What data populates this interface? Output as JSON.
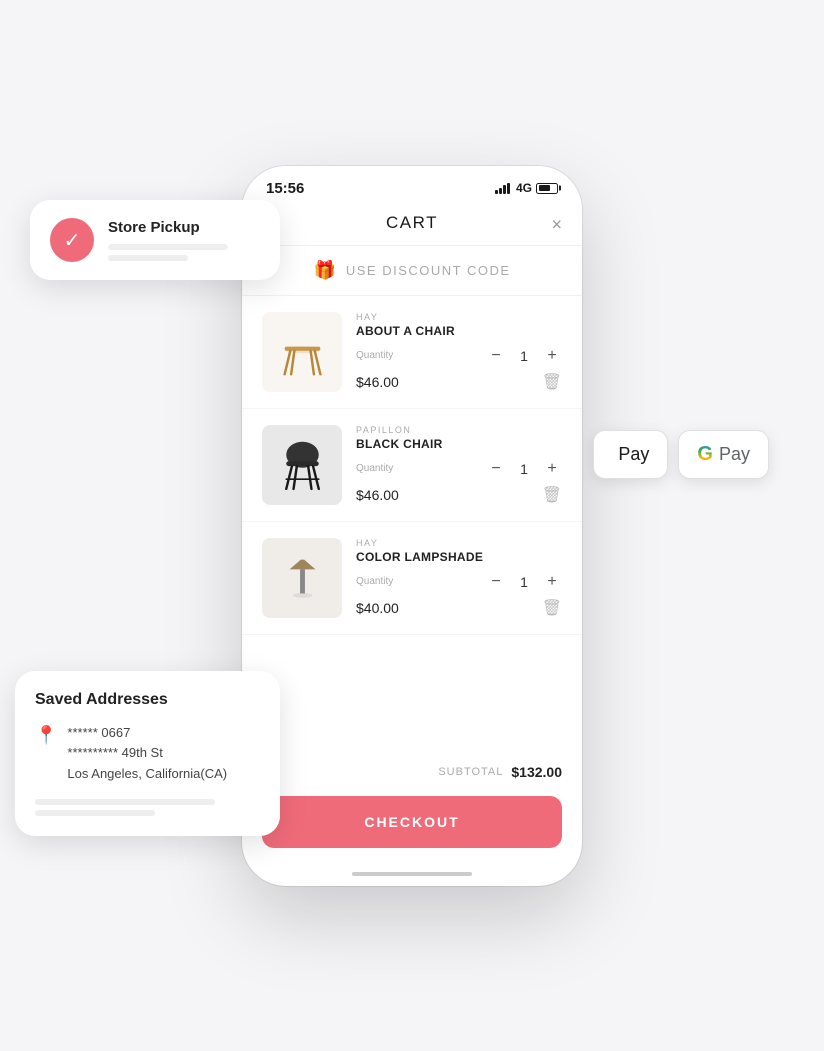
{
  "status_bar": {
    "time": "15:56",
    "network": "4G"
  },
  "header": {
    "title": "CART",
    "close_label": "×"
  },
  "discount": {
    "button_label": "USE DISCOUNT CODE"
  },
  "cart_items": [
    {
      "id": "item-1",
      "category": "HAY",
      "name": "ABOUT A CHAIR",
      "quantity": 1,
      "price": "$46.00",
      "qty_label": "Quantity",
      "type": "chair"
    },
    {
      "id": "item-2",
      "category": "PAPILLON",
      "name": "BLACK CHAIR",
      "quantity": 1,
      "price": "$46.00",
      "qty_label": "Quantity",
      "type": "black-chair"
    },
    {
      "id": "item-3",
      "category": "HAY",
      "name": "COLOR LAMPSHADE",
      "quantity": 1,
      "price": "$40.00",
      "qty_label": "Quantity",
      "type": "lamp"
    }
  ],
  "subtotal": {
    "label": "SUBTOTAL",
    "amount": "$132.00"
  },
  "checkout_button": {
    "label": "CHECKOUT"
  },
  "store_pickup_card": {
    "title": "Store Pickup",
    "icon": "✓"
  },
  "pay_buttons": {
    "apple_pay_label": "Pay",
    "google_pay_label": "Pay"
  },
  "saved_addresses_card": {
    "title": "Saved Addresses",
    "address_line1": "****** 0667",
    "address_line2": "********** 49th St",
    "address_line3": "Los Angeles, California(CA)"
  }
}
